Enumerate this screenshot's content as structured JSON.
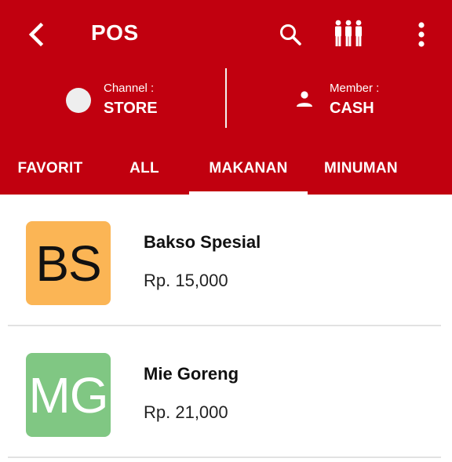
{
  "header": {
    "title": "POS",
    "bg_color": "#c1000f",
    "back_icon": "chevron-left-icon",
    "search_icon": "search-icon",
    "people_icon": "people-group-icon",
    "more_icon": "more-vertical-icon"
  },
  "channel": {
    "label": "Channel :",
    "value": "STORE"
  },
  "member": {
    "label": "Member :",
    "value": "CASH"
  },
  "tabs": [
    {
      "label": "FAVORIT",
      "active": false
    },
    {
      "label": "ALL",
      "active": false
    },
    {
      "label": "MAKANAN",
      "active": true
    },
    {
      "label": "MINUMAN",
      "active": false
    }
  ],
  "products": [
    {
      "initials": "BS",
      "name": "Bakso Spesial",
      "price": "Rp. 15,000",
      "thumb_color": "#fbb555",
      "initials_color": "#111111"
    },
    {
      "initials": "MG",
      "name": "Mie Goreng",
      "price": "Rp. 21,000",
      "thumb_color": "#80c783",
      "initials_color": "#ffffff"
    }
  ]
}
